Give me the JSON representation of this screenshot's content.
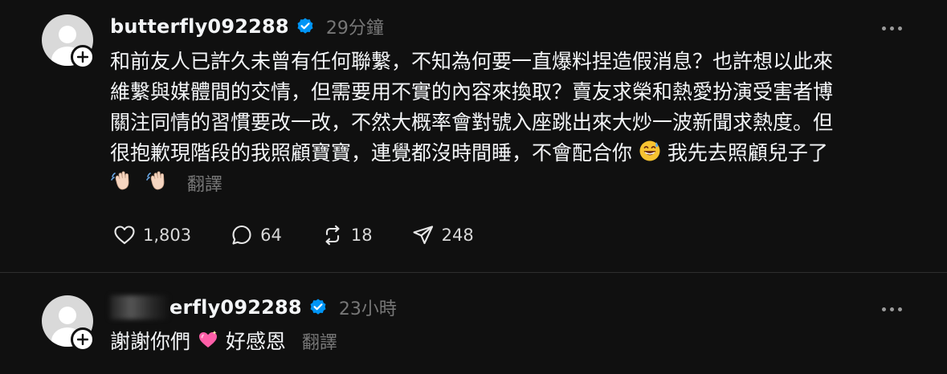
{
  "posts": [
    {
      "username": "butterfly092288",
      "time": "29分鐘",
      "lines": [
        "和前友人已許久未曾有任何聯繫，不知為何要一直爆料捏造假消息？也許想以此來",
        "維繫與媒體間的交情，但需要用不實的內容來換取？賣友求榮和熱愛扮演受害者博",
        "關注同情的習慣要改一改，不然大概率會對號入座跳出來大炒一波新聞求熱度。但",
        "很抱歉現階段的我照顧寶寶，連覺都沒時間睡，不會配合你",
        "我先去照顧兒子了"
      ],
      "translate": "翻譯",
      "actions": {
        "likes": "1,803",
        "replies": "64",
        "reposts": "18",
        "shares": "248"
      }
    },
    {
      "username": "erfly092288",
      "time": "23小時",
      "text": "謝謝你們",
      "text_after": "好感恩",
      "translate": "翻譯"
    }
  ],
  "icons": {
    "verified": "verified-badge-icon",
    "follow": "plus-icon",
    "more": "more-dots-icon",
    "like": "heart-icon",
    "reply": "comment-icon",
    "repost": "repost-icon",
    "share": "send-icon"
  },
  "colors": {
    "background": "#101010",
    "verified": "#0095f6",
    "muted": "#777777"
  }
}
